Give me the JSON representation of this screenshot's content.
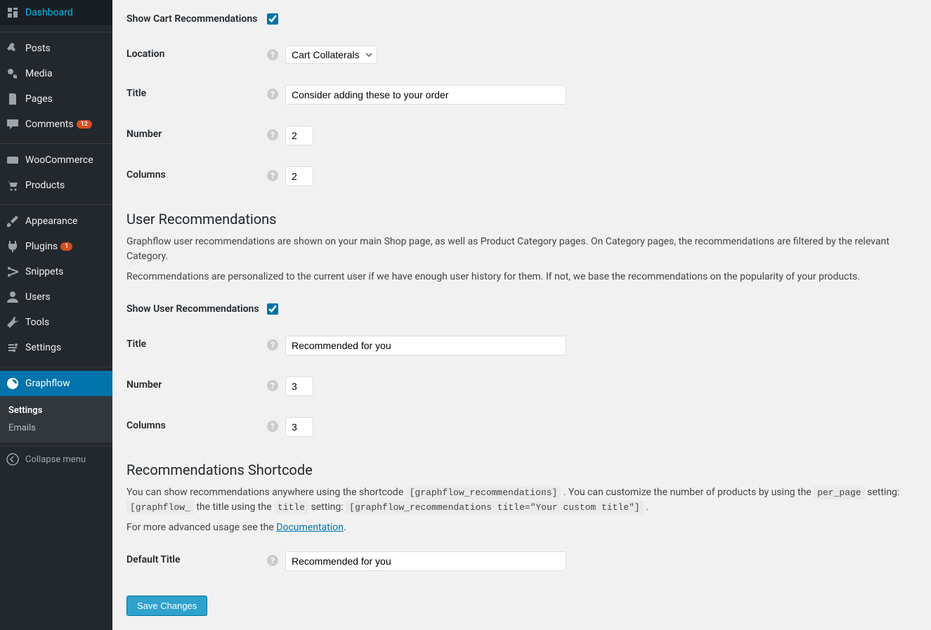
{
  "sidebar": {
    "items": [
      {
        "label": "Dashboard",
        "icon": "dashboard"
      },
      {
        "label": "Posts",
        "icon": "pin"
      },
      {
        "label": "Media",
        "icon": "media"
      },
      {
        "label": "Pages",
        "icon": "pages"
      },
      {
        "label": "Comments",
        "icon": "comment",
        "badge": "12"
      },
      {
        "label": "WooCommerce",
        "icon": "woo"
      },
      {
        "label": "Products",
        "icon": "cart"
      },
      {
        "label": "Appearance",
        "icon": "brush"
      },
      {
        "label": "Plugins",
        "icon": "plug",
        "badge": "1"
      },
      {
        "label": "Snippets",
        "icon": "scissors"
      },
      {
        "label": "Users",
        "icon": "user"
      },
      {
        "label": "Tools",
        "icon": "wrench"
      },
      {
        "label": "Settings",
        "icon": "settings"
      },
      {
        "label": "Graphflow",
        "icon": "graphflow",
        "current": true
      }
    ],
    "submenu": [
      {
        "label": "Settings",
        "current": true
      },
      {
        "label": "Emails"
      }
    ],
    "collapse": "Collapse menu"
  },
  "cart": {
    "show_label": "Show Cart Recommendations",
    "show_checked": true,
    "location_label": "Location",
    "location_value": "Cart Collaterals",
    "title_label": "Title",
    "title_value": "Consider adding these to your order",
    "number_label": "Number",
    "number_value": "2",
    "columns_label": "Columns",
    "columns_value": "2"
  },
  "user_rec": {
    "heading": "User Recommendations",
    "desc1": "Graphflow user recommendations are shown on your main Shop page, as well as Product Category pages. On Category pages, the recommendations are filtered by the relevant Category.",
    "desc2": "Recommendations are personalized to the current user if we have enough user history for them. If not, we base the recommendations on the popularity of your products.",
    "show_label": "Show User Recommendations",
    "show_checked": true,
    "title_label": "Title",
    "title_value": "Recommended for you",
    "number_label": "Number",
    "number_value": "3",
    "columns_label": "Columns",
    "columns_value": "3"
  },
  "shortcode": {
    "heading": "Recommendations Shortcode",
    "p1_a": "You can show recommendations anywhere using the shortcode ",
    "p1_code1": "[graphflow_recommendations]",
    "p1_b": " . You can customize the number of products by using the ",
    "p1_code2": "per_page",
    "p1_c": " setting: ",
    "p1_code3": "[graphflow_",
    "p1_d": " the title using the ",
    "p1_code4": "title",
    "p1_e": " setting: ",
    "p1_code5": "[graphflow_recommendations title=\"Your custom title\"]",
    "p1_f": " .",
    "p2_a": "For more advanced usage see the ",
    "p2_link": "Documentation",
    "p2_b": ".",
    "default_title_label": "Default Title",
    "default_title_value": "Recommended for you"
  },
  "save_label": "Save Changes"
}
